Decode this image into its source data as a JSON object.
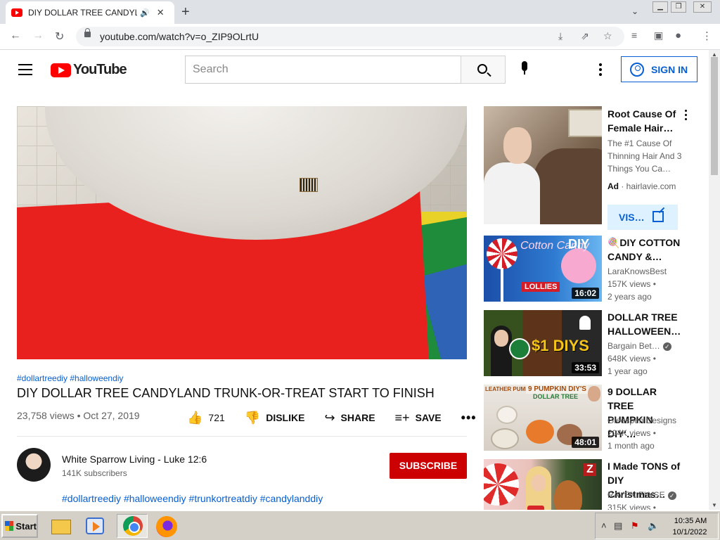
{
  "browser": {
    "tab_title": "DIY DOLLAR TREE CANDYLAND",
    "url": "youtube.com/watch?v=o_ZIP9OLrtU"
  },
  "header": {
    "logo_text": "YouTube",
    "search_placeholder": "Search",
    "signin_label": "SIGN IN"
  },
  "video": {
    "hashtags": "#dollartreediy #halloweendiy",
    "title": "DIY DOLLAR TREE CANDYLAND TRUNK-OR-TREAT START TO FINISH",
    "views_date": "23,758 views • Oct 27, 2019",
    "like_count": "721",
    "dislike_label": "DISLIKE",
    "share_label": "SHARE",
    "save_label": "SAVE"
  },
  "channel": {
    "name": "White Sparrow Living - Luke 12:6",
    "subscribers": "141K subscribers",
    "subscribe_label": "SUBSCRIBE",
    "description_tags": "#dollartreediy #halloweendiy #trunkortreatdiy #candylanddiy"
  },
  "ad": {
    "title": "Root Cause Of Female Hair…",
    "description": "The #1 Cause Of Thinning Hair And 3 Things You Ca…",
    "ad_tag": "Ad",
    "domain": "hairlavie.com",
    "visit_label": "VIS…"
  },
  "recommendations": [
    {
      "title": "🍭DIY COTTON CANDY &…",
      "channel": "LaraKnowsBest",
      "views": "157K views •",
      "age": "2 years ago",
      "duration": "16:02",
      "thumb_text": "Cotton Candy",
      "thumb_diy": "DIY",
      "thumb_lollies": "LOLLIES",
      "verified": false
    },
    {
      "title": "DOLLAR TREE HALLOWEEN…",
      "channel": "Bargain Bet…",
      "views": "648K views •",
      "age": "1 year ago",
      "duration": "33:53",
      "thumb_text": "$1 DIYS",
      "verified": true
    },
    {
      "title": "9 DOLLAR TREE PUMPKIN DIY'…",
      "channel": "Gleespen Designs",
      "views": "204K views •",
      "age": "1 month ago",
      "duration": "48:01",
      "thumb_text": "9 PUMPKIN DIY'S",
      "thumb_sub": "DOLLAR TREE",
      "thumb_leather": "LEATHER PUMPKIN",
      "verified": false
    },
    {
      "title": "I Made TONS of DIY Christmas…",
      "channel": "RAVEN ELYSE",
      "views": "315K views •",
      "age": "",
      "duration": "",
      "thumb_text": "Z",
      "verified": true
    }
  ],
  "taskbar": {
    "start_label": "Start",
    "time": "10:35 AM",
    "date": "10/1/2022"
  }
}
